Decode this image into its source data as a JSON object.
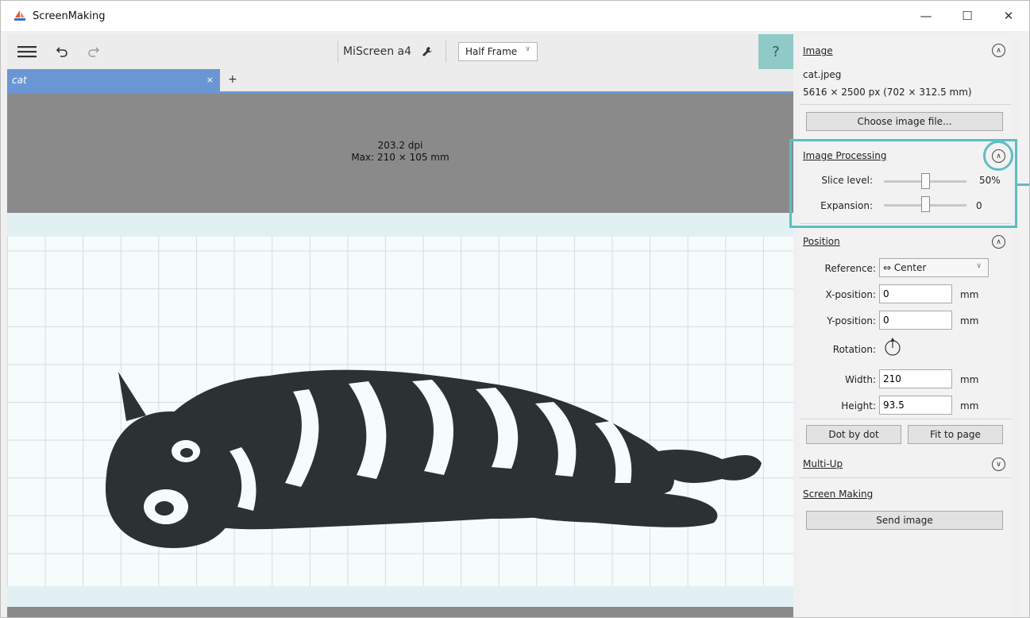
{
  "window": {
    "title": "ScreenMaking",
    "minimize": "—",
    "maximize": "☐",
    "close": "✕"
  },
  "toolbar": {
    "menu_icon": "hamburger-icon",
    "undo_icon": "undo-icon",
    "redo_icon": "redo-icon",
    "device": "MiScreen a4",
    "device_icon": "wrench-icon",
    "frame": "Half Frame",
    "help": "?"
  },
  "tabs": [
    {
      "label": "cat",
      "close": "×"
    }
  ],
  "tab_add": "+",
  "canvas": {
    "dpi": "203.2 dpi",
    "max": "Max: 210 × 105 mm"
  },
  "panel": {
    "image": {
      "header": "Image",
      "filename": "cat.jpeg",
      "dimensions": "5616 × 2500 px  (702 × 312.5 mm)",
      "choose_button": "Choose image file..."
    },
    "processing": {
      "header": "Image Processing",
      "slice_label": "Slice level:",
      "slice_value": "50%",
      "slice_level": 0.5,
      "expansion_label": "Expansion:",
      "expansion_value": "0",
      "expansion_level": 0.5
    },
    "position": {
      "header": "Position",
      "reference_label": "Reference:",
      "reference_value": "⇔ Center",
      "x_label": "X-position:",
      "x_value": "0",
      "y_label": "Y-position:",
      "y_value": "0",
      "rotation_label": "Rotation:",
      "width_label": "Width:",
      "width_value": "210",
      "height_label": "Height:",
      "height_value": "93.5",
      "unit": "mm"
    },
    "dot_by_dot": "Dot by dot",
    "fit_to_page": "Fit to page",
    "multiup": {
      "header": "Multi-Up"
    },
    "screen_making": {
      "header": "Screen Making",
      "send_button": "Send image"
    }
  },
  "colors": {
    "accent": "#5cbec3",
    "tab": "#6a97d4",
    "help": "#8fc9c8"
  }
}
